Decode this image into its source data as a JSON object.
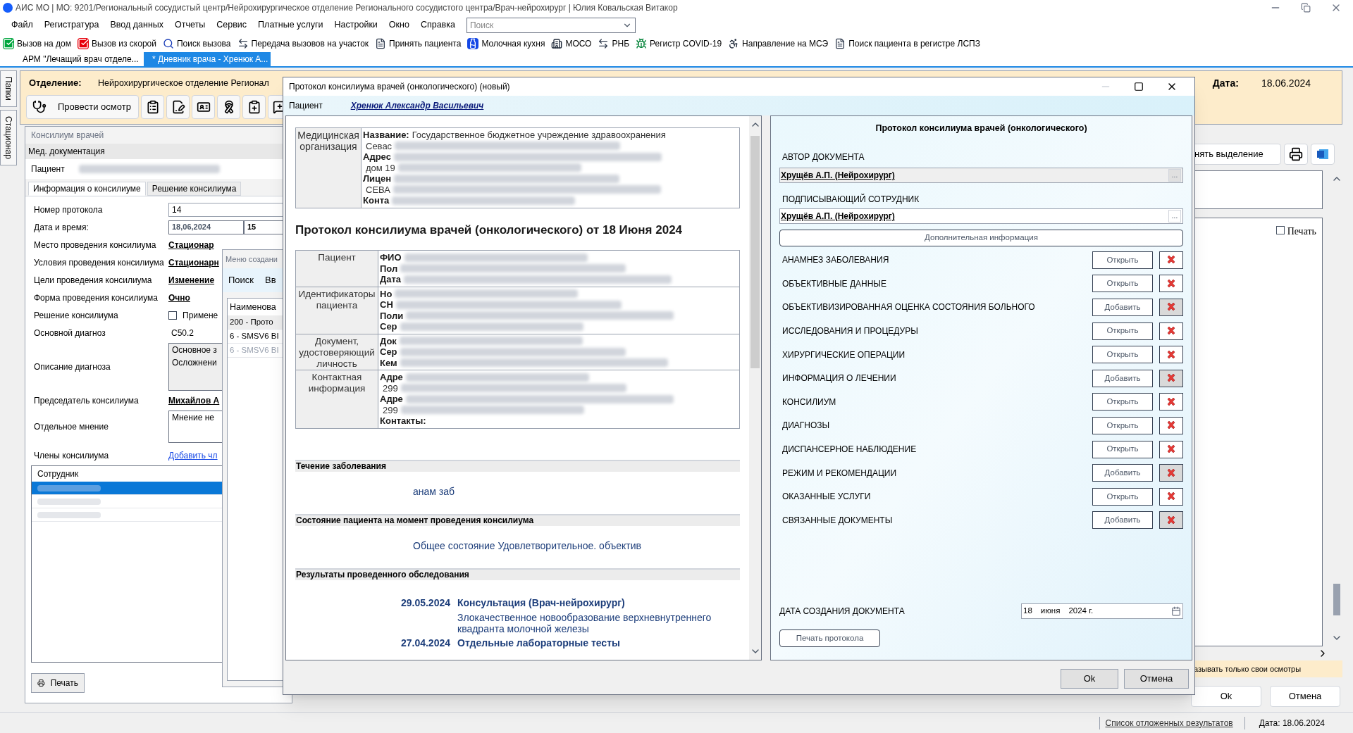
{
  "window": {
    "title": "АИС МО | МО: 9201/Региональный сосудистый центр/Нейрохирургическое отделение Регионального сосудистого центра/Врач-нейрохирург | Юлия Ковальская Витакор"
  },
  "menu": [
    "Файл",
    "Регистратура",
    "Ввод данных",
    "Отчеты",
    "Сервис",
    "Платные услуги",
    "Настройки",
    "Окно",
    "Справка"
  ],
  "search": {
    "placeholder": "Поиск"
  },
  "toolbar": [
    {
      "label": "Вызов на дом",
      "kind": "check"
    },
    {
      "label": "Вызов из скорой",
      "kind": "check-red"
    },
    {
      "label": "Поиск вызова",
      "kind": "search"
    },
    {
      "label": "Передача вызовов на участок",
      "kind": "transfer"
    },
    {
      "label": "Принять пациента",
      "kind": "doc"
    },
    {
      "label": "Молочная кухня",
      "kind": "bottle"
    },
    {
      "label": "МОСО",
      "kind": "building"
    },
    {
      "label": "РНБ",
      "kind": "transfer"
    },
    {
      "label": "Регистр COVID-19",
      "kind": "virus"
    },
    {
      "label": "Направление на МСЭ",
      "kind": "wheelchair"
    },
    {
      "label": "Поиск пациента в регистре ЛСПЗ",
      "kind": "doc"
    }
  ],
  "doc_tabs": [
    {
      "label": "АРМ \"Лечащий врач отделе...",
      "selected": false
    },
    {
      "label": "* Дневник врача - Хренюк А...",
      "selected": true
    }
  ],
  "side_tabs": [
    "Папки",
    "Стационар"
  ],
  "header": {
    "department_label": "Отделение:",
    "department": "Нейрохирургическое отделение Регионал",
    "date_label": "Дата:",
    "date": "18.06.2024",
    "exam_button": "Провести осмотр"
  },
  "consilium": {
    "title": "Консилиум врачей",
    "section": "Мед. документация",
    "patient_label": "Пациент",
    "tabs": [
      {
        "label": "Информация о консилиуме",
        "selected": true
      },
      {
        "label": "Решение консилиума",
        "selected": false
      }
    ],
    "fields": [
      {
        "label": "Номер протокола",
        "kind": "text",
        "value": "14"
      },
      {
        "label": "Дата и время:",
        "kind": "datetime",
        "value": "18,06,2024",
        "time": "15"
      },
      {
        "label": "Место проведения консилиума",
        "kind": "link",
        "value": "Стационар"
      },
      {
        "label": "Условия проведения консилиума",
        "kind": "link",
        "value": "Стационарн"
      },
      {
        "label": "Цели проведения консилиума",
        "kind": "link",
        "value": "Изменение"
      },
      {
        "label": "Форма проведения консилиума",
        "kind": "link",
        "value": "Очно"
      },
      {
        "label": "Решение консилиума",
        "kind": "checkbox",
        "value": "Примене",
        "checked": false
      },
      {
        "label": "Основной диагноз",
        "kind": "plain",
        "value": "C50.2"
      },
      {
        "label": "Описание диагноза",
        "kind": "memo",
        "lines": [
          "Основное з",
          "Осложнени"
        ]
      },
      {
        "label": "Председатель консилиума",
        "kind": "link",
        "value": "Михайлов А"
      },
      {
        "label": "Отдельное мнение",
        "kind": "memo-small",
        "lines": [
          "Мнение не"
        ]
      }
    ],
    "members_label": "Члены консилиума",
    "add_member": "Добавить чл",
    "members_header": "Сотрудник",
    "members": [
      {
        "selected": true
      },
      {
        "selected": false
      },
      {
        "selected": false
      }
    ],
    "print_button": "Печать"
  },
  "create_menu": {
    "title": "Меню создани",
    "tabs": [
      "Поиск",
      "Вв"
    ],
    "header": "Наименова",
    "rows": [
      {
        "label": "200 - Прото",
        "disabled": false,
        "selected": true
      },
      {
        "label": "6 - SMSV6 ВІ",
        "disabled": false,
        "selected": false
      },
      {
        "label": "6 - SMSV6 ВІ",
        "disabled": true,
        "selected": false
      }
    ]
  },
  "background_right": {
    "clear_button": "нять выделение",
    "print_check": {
      "label": "Печать",
      "checked": false
    },
    "own_exams": "азывать только свои осмотры",
    "ok": "Ok",
    "cancel": "Отмена"
  },
  "dialog": {
    "title": "Протокол консилиума врачей (онкологического) (новый)",
    "patient_label": "Пациент",
    "patient": "Хренюк Александр Васильевич",
    "org": {
      "label": "Медицинская организация",
      "lines": [
        {
          "key": "Название:",
          "value": "Государственное бюджетное учреждение здравоохранения",
          "redacted": false
        },
        {
          "value": "Севас",
          "redacted": true
        },
        {
          "key": "Адрес",
          "redacted": true
        },
        {
          "value": "дом 19",
          "redacted": true
        },
        {
          "key": "Лицен",
          "redacted": true
        },
        {
          "value": "СЕВА",
          "redacted": true
        },
        {
          "key": "Конта",
          "redacted": true
        }
      ]
    },
    "heading": "Протокол консилиума врачей (онкологического) от 18 Июня 2024",
    "patient_table": [
      {
        "label": "Пациент",
        "lines": [
          {
            "key": "ФИО",
            "redacted": true
          },
          {
            "key": "Пол",
            "redacted": true
          },
          {
            "key": "Дата",
            "redacted": true
          }
        ]
      },
      {
        "label": "Идентификаторы пациента",
        "lines": [
          {
            "key": "Но",
            "redacted": true
          },
          {
            "key": "СН",
            "redacted": true
          },
          {
            "key": "Поли",
            "redacted": true
          },
          {
            "key": "Сер",
            "redacted": true
          }
        ]
      },
      {
        "label": "Документ, удостоверяющий личность",
        "lines": [
          {
            "key": "Док",
            "redacted": true
          },
          {
            "key": "Сер",
            "redacted": true
          },
          {
            "key": "Кем",
            "redacted": true
          }
        ]
      },
      {
        "label": "Контактная информация",
        "lines": [
          {
            "key": "Адре",
            "redacted": true
          },
          {
            "value": "299",
            "redacted": true
          },
          {
            "key": "Адре",
            "redacted": true
          },
          {
            "value": "299",
            "redacted": true
          },
          {
            "key": "Контакты:",
            "redacted": false
          }
        ]
      }
    ],
    "sections": [
      {
        "title": "Течение заболевания",
        "kind": "text",
        "text": "анам заб"
      },
      {
        "title": "Состояние пациента на момент проведения консилиума",
        "kind": "text",
        "text": "Общее состояние Удовлетворительное. объектив"
      },
      {
        "title": "Результаты проведенного обследования",
        "kind": "results",
        "results": [
          {
            "date": "29.05.2024",
            "title": "Консультация (Врач-нейрохирург)",
            "text": "Злокачественное новообразование верхневнутреннего квадранта молочной железы"
          },
          {
            "date": "27.04.2024",
            "title": "Отдельные лабораторные тесты"
          }
        ]
      }
    ],
    "panel_title": "Протокол консилиума врачей (онкологического)",
    "author_label": "АВТОР ДОКУМЕНТА",
    "author": {
      "value": "Хрущёв А.П. (Нейрохирург)",
      "disabled": true
    },
    "signer_label": "ПОДПИСЫВАЮЩИЙ СОТРУДНИК",
    "signer": {
      "value": "Хрущёв А.П. (Нейрохирург)",
      "disabled": false
    },
    "browse": "...",
    "extra_button": "Дополнительная информация",
    "parts": [
      {
        "label": "АНАМНЕЗ ЗАБОЛЕВАНИЯ",
        "action": "Открыть",
        "filled": true
      },
      {
        "label": "ОБЪЕКТИВНЫЕ ДАННЫЕ",
        "action": "Открыть",
        "filled": true
      },
      {
        "label": "ОБЪЕКТИВИЗИРОВАННАЯ ОЦЕНКА СОСТОЯНИЯ БОЛЬНОГО",
        "action": "Добавить",
        "filled": false
      },
      {
        "label": "ИССЛЕДОВАНИЯ И ПРОЦЕДУРЫ",
        "action": "Открыть",
        "filled": true
      },
      {
        "label": "ХИРУРГИЧЕСКИЕ ОПЕРАЦИИ",
        "action": "Открыть",
        "filled": true
      },
      {
        "label": "ИНФОРМАЦИЯ О ЛЕЧЕНИИ",
        "action": "Добавить",
        "filled": false
      },
      {
        "label": "КОНСИЛИУМ",
        "action": "Открыть",
        "filled": true
      },
      {
        "label": "ДИАГНОЗЫ",
        "action": "Открыть",
        "filled": true
      },
      {
        "label": "ДИСПАНСЕРНОЕ НАБЛЮДЕНИЕ",
        "action": "Открыть",
        "filled": true
      },
      {
        "label": "РЕЖИМ И РЕКОМЕНДАЦИИ",
        "action": "Добавить",
        "filled": false
      },
      {
        "label": "ОКАЗАННЫЕ УСЛУГИ",
        "action": "Открыть",
        "filled": true
      },
      {
        "label": "СВЯЗАННЫЕ ДОКУМЕНТЫ",
        "action": "Добавить",
        "filled": false
      }
    ],
    "date_label": "ДАТА СОЗДАНИЯ ДОКУМЕНТА",
    "date": {
      "day": "18",
      "month": "июня",
      "year": "2024 г."
    },
    "print_button": "Печать протокола",
    "ok": "Ok",
    "cancel": "Отмена"
  },
  "status_bar": {
    "link": "Список отложенных результатов",
    "date": "Дата: 18.06.2024"
  }
}
